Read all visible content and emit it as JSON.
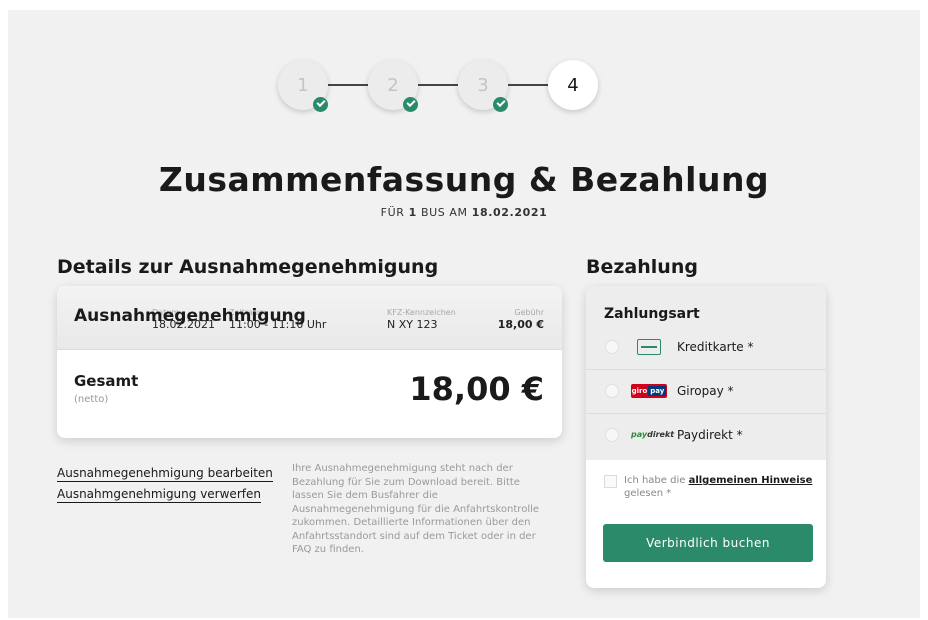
{
  "stepper": {
    "steps": [
      {
        "label": "1",
        "done": true
      },
      {
        "label": "2",
        "done": true
      },
      {
        "label": "3",
        "done": true
      },
      {
        "label": "4",
        "done": false
      }
    ],
    "active_step": "4"
  },
  "header": {
    "title": "Zusammenfassung & Bezahlung",
    "subtitle_prefix": "FÜR",
    "bus_count": "1",
    "subtitle_mid": "BUS AM",
    "date": "18.02.2021"
  },
  "details": {
    "heading": "Details zur Ausnahmegenehmigung",
    "permit_name": "Ausnahmegenehmigung",
    "date_label": "Datum",
    "date_value": "18.02.2021",
    "time_label": "Zeitraum",
    "time_value": "11:00 - 11:10 Uhr",
    "plate_label": "KFZ-Kennzeichen",
    "plate_value": "N XY 123",
    "fee_label": "Gebühr",
    "fee_value": "18,00 €",
    "total_label": "Gesamt",
    "total_net": "(netto)",
    "total_value": "18,00 €"
  },
  "links": {
    "edit": "Ausnahmegenehmigung bearbeiten",
    "discard": "Ausnahmgenehmigung verwerfen"
  },
  "info_text": "Ihre Ausnahmegenehmigung steht nach der Bezahlung für Sie zum Download bereit. Bitte lassen Sie dem Busfahrer die Ausnahmegenehmigung für die Anfahrtskontrolle zukommen. Detaillierte Informationen über den Anfahrtsstandort sind auf dem Ticket oder in der FAQ zu finden.",
  "payment": {
    "heading": "Bezahlung",
    "method_label": "Zahlungsart",
    "options": [
      {
        "name": "Kreditkarte *",
        "icon": "credit-card-icon"
      },
      {
        "name": "Giropay *",
        "icon": "giropay-logo",
        "logo_text_a": "giro",
        "logo_text_b": "pay"
      },
      {
        "name": "Paydirekt *",
        "icon": "paydirekt-logo",
        "logo_text_a": "pay",
        "logo_text_b": "direkt"
      }
    ],
    "terms_prefix": "Ich habe die",
    "terms_link": "allgemeinen Hinweise",
    "terms_suffix": "gelesen *",
    "book_button": "Verbindlich buchen"
  },
  "colors": {
    "accent": "#2a8a6a",
    "background": "#f1f1f1"
  }
}
